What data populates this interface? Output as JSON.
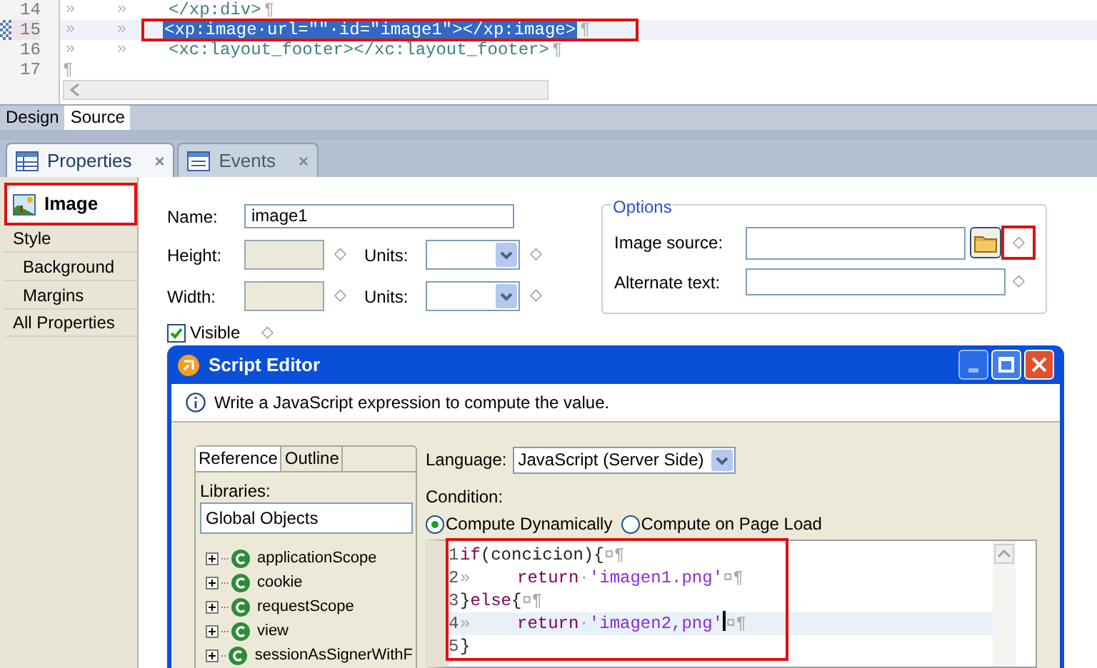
{
  "source_editor": {
    "lines": [
      {
        "number": "14",
        "guides": [
          "»",
          "»"
        ],
        "code": "</xp:div>",
        "end": "¶",
        "selected": false
      },
      {
        "number": "15",
        "guides": [
          "»",
          "»"
        ],
        "code": "<xp:image·url=\"\"·id=\"image1\"></xp:image>",
        "end": "¶",
        "selected": true
      },
      {
        "number": "16",
        "guides": [
          "»",
          "»"
        ],
        "code": "<xc:layout_footer></xc:layout_footer>",
        "end": "¶",
        "selected": false
      },
      {
        "number": "17",
        "end": "¶",
        "selected": false
      }
    ],
    "tabs": [
      {
        "label": "Design",
        "selected": false
      },
      {
        "label": "Source",
        "selected": true
      }
    ]
  },
  "view_tabs": [
    {
      "label": "Properties",
      "close": "×",
      "selected": true
    },
    {
      "label": "Events",
      "close": "×",
      "selected": false
    }
  ],
  "nav": [
    {
      "label": "Image",
      "kind": "header",
      "selected": true
    },
    {
      "label": "Style",
      "kind": "section",
      "selected": false
    },
    {
      "label": "Background",
      "kind": "sub",
      "selected": false
    },
    {
      "label": "Margins",
      "kind": "sub",
      "selected": false
    },
    {
      "label": "All Properties",
      "kind": "section",
      "selected": false
    }
  ],
  "form": {
    "name_label": "Name:",
    "name_value": "image1",
    "height_label": "Height:",
    "width_label": "Width:",
    "units_label_1": "Units:",
    "units_label_2": "Units:",
    "diamonds": [
      "◇",
      "◇",
      "◇",
      "◇",
      "◇"
    ],
    "visible": {
      "label": "Visible",
      "checked": true
    }
  },
  "options": {
    "legend": "Options",
    "image_source_label": "Image source:",
    "alt_text_label": "Alternate text:",
    "diamonds": [
      "◇",
      "◇"
    ]
  },
  "dialog": {
    "title": "Script Editor",
    "info": "Write a JavaScript expression to compute the value.",
    "tabs": [
      {
        "label": "Reference",
        "selected": true
      },
      {
        "label": "Outline",
        "selected": false
      }
    ],
    "libraries_label": "Libraries:",
    "libraries_value": "Global Objects",
    "tree": [
      "applicationScope",
      "cookie",
      "requestScope",
      "view",
      "sessionAsSignerWithF"
    ],
    "language_label": "Language:",
    "language_value": "JavaScript (Server Side)",
    "condition_label": "Condition:",
    "radios": [
      {
        "label": "Compute Dynamically",
        "selected": true
      },
      {
        "label": "Compute on Page Load",
        "selected": false
      }
    ],
    "code": [
      {
        "number": "1",
        "current": false,
        "segments": [
          {
            "kind": "kw",
            "text": "if"
          },
          {
            "kind": "code",
            "text": "(concicion){"
          },
          {
            "kind": "mark",
            "text": "¤¶"
          }
        ]
      },
      {
        "number": "2",
        "current": false,
        "segments": [
          {
            "kind": "guide",
            "text": "»"
          },
          {
            "kind": "kw",
            "text": "return"
          },
          {
            "kind": "mark",
            "text": "·"
          },
          {
            "kind": "str",
            "text": "'imagen1.png'"
          },
          {
            "kind": "mark",
            "text": "¤¶"
          }
        ]
      },
      {
        "number": "3",
        "current": false,
        "segments": [
          {
            "kind": "code",
            "text": "}"
          },
          {
            "kind": "kw",
            "text": "else"
          },
          {
            "kind": "code",
            "text": "{"
          },
          {
            "kind": "mark",
            "text": "¤¶"
          }
        ]
      },
      {
        "number": "4",
        "current": true,
        "segments": [
          {
            "kind": "guide",
            "text": "»"
          },
          {
            "kind": "kw",
            "text": "return"
          },
          {
            "kind": "mark",
            "text": "·"
          },
          {
            "kind": "str",
            "text": "'imagen2,png'"
          },
          {
            "kind": "mark",
            "text": "¤¶"
          }
        ]
      },
      {
        "number": "5",
        "current": false,
        "segments": [
          {
            "kind": "code",
            "text": "}"
          }
        ]
      }
    ]
  }
}
